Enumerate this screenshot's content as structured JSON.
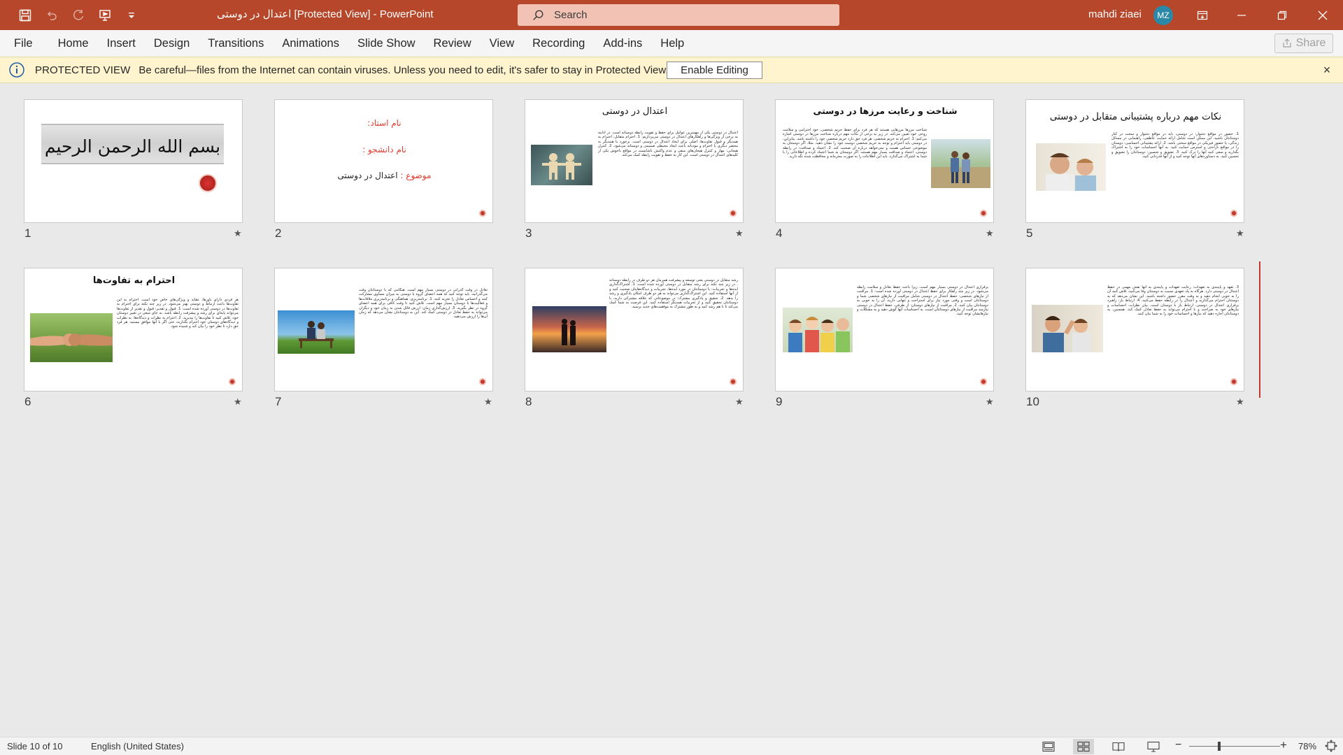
{
  "app": {
    "doc_title": "اعتدال در دوستی  [Protected View]  -  PowerPoint",
    "search_placeholder": "Search",
    "user_name": "mahdi ziaei",
    "user_initials": "MZ"
  },
  "ribbon": {
    "tabs": [
      "File",
      "Home",
      "Insert",
      "Design",
      "Transitions",
      "Animations",
      "Slide Show",
      "Review",
      "View",
      "Recording",
      "Add-ins",
      "Help"
    ],
    "share_label": "Share"
  },
  "protected_view": {
    "title": "PROTECTED VIEW",
    "message": "Be careful—files from the Internet can contain viruses. Unless you need to edit, it's safer to stay in Protected View.",
    "enable_label": "Enable Editing",
    "close_glyph": "×"
  },
  "slides": [
    {
      "number": "1",
      "star": "★",
      "title": "بسم الله الرحمن الرحیم"
    },
    {
      "number": "2",
      "star": "",
      "line1": "نام استاد:",
      "line2": "نام دانشجو :",
      "line3_label": "موضوع :",
      "line3_value": "اعتدال در دوستی"
    },
    {
      "number": "3",
      "star": "★",
      "title": "اعتدال در دوستی",
      "body": "اعتدال در دوستی یکی از مهمترین عوامل برای حفظ و تقویت رابطه دوستانه است. در ادامه به برخی از ویژگی‌ها و راهکارهای اعتدال در دوستی می‌پردازیم: 1. احترام متقابل: احترام به همدیگر و قبول تفاوت‌ها، اصلی برای ایجاد اعتدال در دوستی است. برخورد با همدیگر به محضر دیگری با احترام و مودبانه باعث ایجاد محیطی صمیمی و دوستانه می‌شود. 2. کنترل هیجانی: مهار و کنترل هیجان‌های منفی و عدم واکنش ناشایست در مواقع ناخوش یکی از کلیدهای اعتدال در دوستی است. این کار به حفظ و تقویت رابطه کمک می‌کند."
    },
    {
      "number": "4",
      "star": "★",
      "title": "شناخت و رعایت مرزها در دوستی",
      "body": "شناخت مرزها مرزهایی هستند که هر فرد برای حفظ حریم شخصی، خود احترامی و سلامت روحی خود تعیین می‌کند. در زیر به برخی از نکات مهم درباره شناخت مرزها در دوستی اشاره می‌کنم: 1. احترام به حریم شخصی: هر فرد حق دارد حریم شخصی خود را داشته باشد. بنابراین، در دوستی باید احترام و توجه به حریم شخصی دوست خود را نشان دهید. مثلا، اگر دوستتان به موضوعی حساس هست و نمی‌خواهد درباره آن صحبت کند. 2. اعتماد و صداقت: در رابطه دوستی، اعتماد و صداقت بسیار مهم هستند. اگر دوستتان به شما اعتماد کرده و اطلاعاتی را با شما به اشتراک می‌گذارد، باید این اطلاعات را به صورت محرمانه و محافظت شده نگه دارید."
    },
    {
      "number": "5",
      "star": "★",
      "title": "نکات مهم درباره پشتیبانی متقابل در دوستی",
      "body": "1. حضور در مواقع دشوار: در دوستی، باید در مواقع دشوار و سخت در کنار دوستانتان باشید. این ممکن است شامل ارائه حمایت عاطفی، راهنمایی در مسائل زندگی، یا حضور فیزیکی در مواقع سختی باشد. 2. ارائه پشتیبانی احساسی: دوستان را در مواقع ناراحتی و استرس حمایت کنید. به آنها احساسات خود را به اشتراک بگذارید و سعی کنید آنها را درک کنید. 3. تشویق و تحسین: دوستانتان را تشویق و تحسین کنید. به دستاوردهای آنها توجه کنید و از آنها قدردانی کنید."
    },
    {
      "number": "6",
      "star": "★",
      "title": "احترام به تفاوت‌ها",
      "body": "هر فردی دارای باورها، عقاید و ویژگی‌های خاص خود است. احترام به این تفاوت‌ها باعث ارتباط و دوستی بهتر می‌شود. در زیر چند نکته برای احترام به تفاوت‌ها در دوستی آورده شده است: 1. قبول و تقدیر: قبول و تقدیر از تفاوت‌ها می‌تواند پایه‌ای برای رشد و پیشرفت رابطه باشد. به جای سعی در تغییر دوستان خود، تلاش کنید تا تفاوت‌ها را بپذیرید. 2. احترام به نظرات و دیدگاه‌ها: به نظرات و دیدگاه‌های دوستان خود احترام بگذارید، حتی اگر با آنها موافق نیستید. هر فرد حق دارد تا نظر خود را بیان کند و شنیده شود."
    },
    {
      "number": "7",
      "star": "★",
      "body": "تعادل در وقت گذرانی در دوستی بسیار مهم است. هنگامی که با دوستانتان وقت می‌گذرانید، باید توجه کنید که همه اعضای گروه یا دوستی به میزان مساوی مشارکت کنند و احساس تعادل را تجربه کنند. 1. برنامه‌ریزی: هماهنگی و برنامه‌ریزی ملاقات‌ها و فعالیت‌ها با دوستان بسیار مهم است. تلاش کنید تا وقت کافی برای همه اعضای گروه در نظر بگیرید. 3. ارزش‌گذاری زمان: ارزش قائل شدن به زمان خود و دیگران می‌تواند به حفظ تعادل در دوستی کمک کند. این به دوستانتان نشان می‌دهد که زمان آن‌ها را ارزش می‌دهید."
    },
    {
      "number": "8",
      "star": "★",
      "body": "رشد متقابل در دوستی یعنی توسعه و پیشرفت همزمان هر دو طرف در رابطه دوستانه . در زیر چند نکته برای رشد متقابل در دوستی آورده شده است: 1. اشتراک‌گذاری ایده‌ها و تجربیات: با دوستانتان در مورد ایده‌ها، تجربیات و دیدگاه‌هایتان صحبت کنید و از آنها استفاده کنید. این اشتراک‌گذاری می‌تواند به هر دو طرف امکان یادگیری و رشد را بدهد. 2. تحقیق و یادگیری مشترک: در موضوعاتی که علاقه مشترکی دارید، با دوستانتان تحقیق کنید و از تجربیات همدیگر استفاده کنید. این فرصت به شما کمک می‌کند تا با هم رشد کنید و به طور مشترک به موفقیت‌های جدید برسید."
    },
    {
      "number": "9",
      "star": "★",
      "body": "برقراری اعتدال در دوستی بسیار مهم است، زیرا باعث حفظ تعادل و سلامت رابطه می‌شود. در زیر چند راهکار برای حفظ اعتدال در دوستی آورده شده است: 1. مراقبت از نیازهای شخصی: حفظ اعتدال در دوستی شامل مراقبت از نیازهای شخصی شما و دوستانتان است و وقتی مورد نیاز برای استراحت و تنهایی دارید، آن را به خوبی به دوستانتان بیان کنید. 2. مراقبت از نیازهای دوستان: از طرفی، حفظ اعتدال در دوستی نیازمند مراقبت از نیازهای دوستانتان است. به احساسات آنها گوش دهید و به مشکلات و نیازهایشان توجه کنید."
    },
    {
      "number": "10",
      "star": "★",
      "body": "3. تعهد و پایبندی به تعهدات: رعایت تعهدات و پایبندی به آنها نقش مهمی در حفظ اعتدال در دوستی دارد. هرگاه به یک تعهدی نسبت به دوستتان وفا می‌کنید، تلاش کنید آن را به خوبی انجام دهید و به وقت مقرر حضور داشته باشید. این نشان می‌دهد که به دوستتان احترام می‌گذارید و اعتدال را در رابطه حفظ می‌کنید. 4. ارتباط باز: راهبرد برقراری اعتدال در دوستی، ارتباط باز با دوستان است. بیان نظرات، احساسات و نیازهای خود به صراحت و با احترام می‌تواند به حفظ تعادل کمک کند. همچنین، به دوستانتان اجازه دهید که نیازها و احساسات خود را به شما بیان کنند."
    }
  ],
  "statusbar": {
    "slide_info": "Slide 10 of 10",
    "language": "English (United States)",
    "zoom_minus": "−",
    "zoom_plus": "+",
    "zoom_percent": "78%",
    "zoom_level_fraction": 0.33
  },
  "colors": {
    "title_bar": "#b7472a",
    "accent_red": "#c0392b",
    "protected_bar": "#fff4ce"
  },
  "icons": [
    "save-icon",
    "undo-icon",
    "redo-icon",
    "present-icon",
    "customize-qat-icon",
    "search-icon",
    "ribbon-display-icon",
    "minimize-icon",
    "restore-icon",
    "close-icon",
    "share-icon",
    "info-icon",
    "normal-view-icon",
    "slide-sorter-icon",
    "reading-view-icon",
    "slideshow-icon",
    "fit-slide-icon"
  ]
}
